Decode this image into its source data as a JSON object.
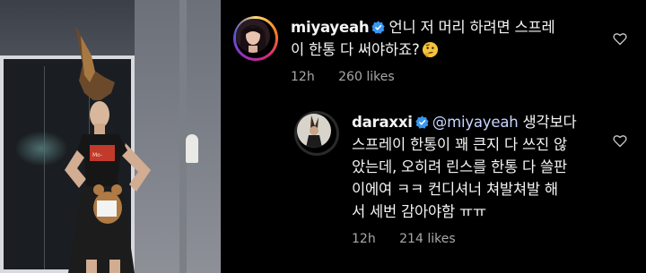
{
  "photo": {
    "icon": "portrait-photo"
  },
  "comments": [
    {
      "username": "miyayeah",
      "verified": true,
      "lines": [
        "언니 저 머리 하려면 스프레",
        "이 한통 다 써야하죠?"
      ],
      "emoji": "thinking-face",
      "time": "12h",
      "likes": "260 likes"
    },
    {
      "username": "daraxxi",
      "verified": true,
      "mention": "@miyayeah",
      "lines": [
        " 생각보다",
        "스프레이 한통이 꽤 큰지 다 쓰진 않",
        "았는데, 오히려 린스를 한통 다 쓸판",
        "이에여 ㅋㅋ 컨디셔너 쳐발쳐발 해",
        "서 세번 감아야함 ㅠㅠ"
      ],
      "time": "12h",
      "likes": "214 likes"
    }
  ],
  "colors": {
    "verified": "#3897f0",
    "meta": "#a8a8a8",
    "text": "#f5f5f5"
  }
}
